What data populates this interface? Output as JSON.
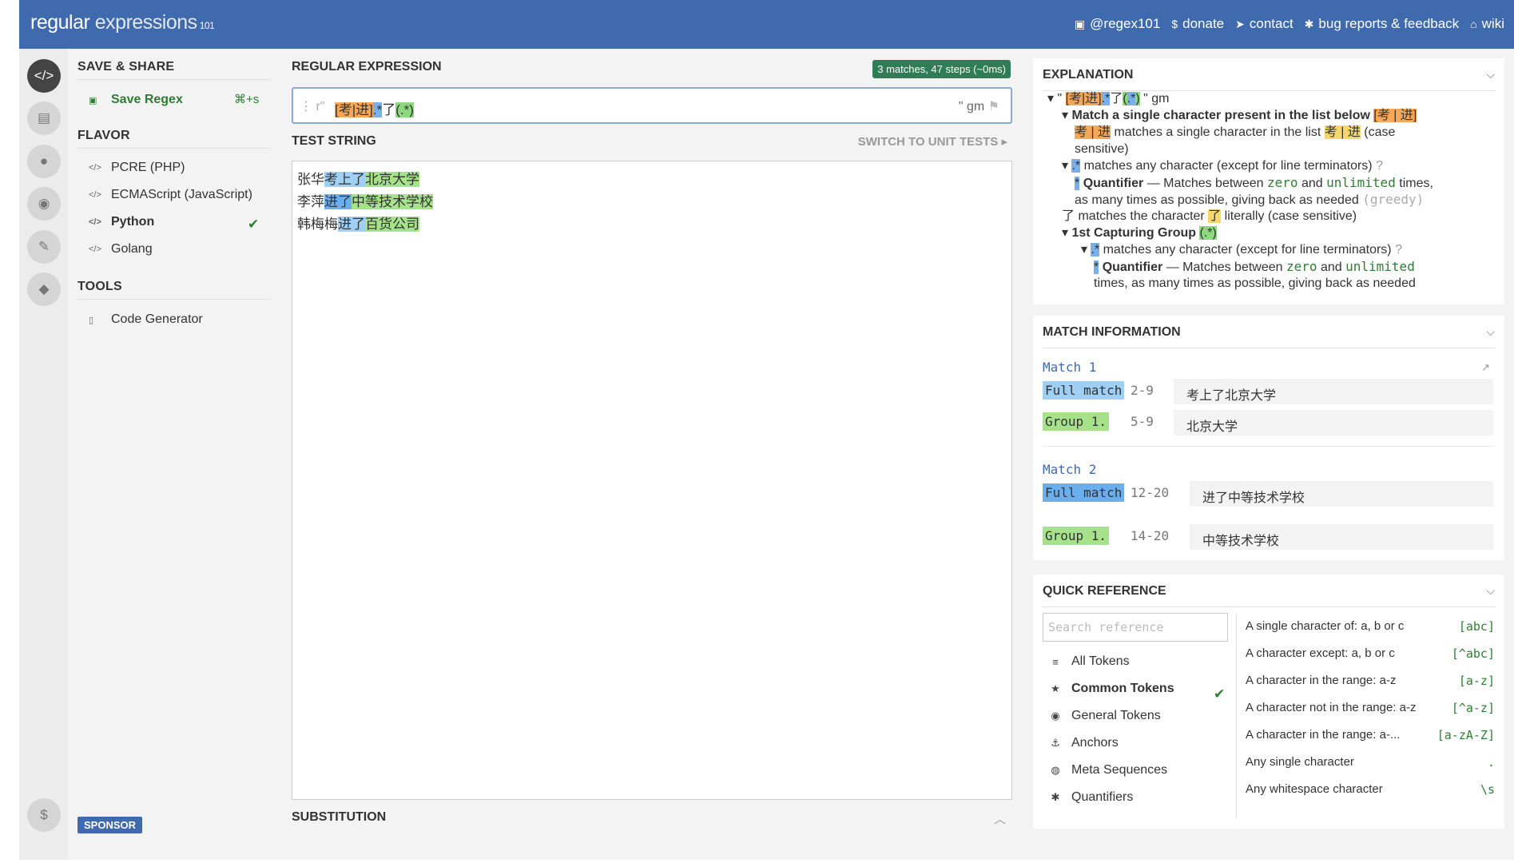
{
  "header": {
    "logo_main": "regular",
    "logo_second": " expressions",
    "logo_small": "101",
    "links": [
      {
        "icon": "twitter-icon",
        "label": "@regex101"
      },
      {
        "icon": "dollar-icon",
        "label": "donate"
      },
      {
        "icon": "send-icon",
        "label": "contact"
      },
      {
        "icon": "bug-icon",
        "label": "bug reports & feedback"
      },
      {
        "icon": "bank-icon",
        "label": "wiki"
      }
    ]
  },
  "sidebar": {
    "save_share_title": "SAVE & SHARE",
    "save_label": "Save Regex",
    "save_shortcut": "⌘+s",
    "flavor_title": "FLAVOR",
    "flavors": [
      "PCRE (PHP)",
      "ECMAScript (JavaScript)",
      "Python",
      "Golang"
    ],
    "selected_flavor": "Python",
    "tools_title": "TOOLS",
    "tool_code_generator": "Code Generator",
    "sponsor": "SPONSOR"
  },
  "regex": {
    "section_title": "REGULAR EXPRESSION",
    "status_badge": "3 matches, 47 steps (~0ms)",
    "prefix": "r\"",
    "pattern_class": "[考|进]",
    "pattern_any": ".*",
    "pattern_literal": "了",
    "pattern_group": "(.*)",
    "suffix": "\" gm",
    "flags": "\" gm"
  },
  "test_string": {
    "section_title": "TEST STRING",
    "switch_label": "SWITCH TO UNIT TESTS",
    "lines": [
      {
        "pre": "张华",
        "full": "考上了",
        "grp": "北京大学"
      },
      {
        "pre": "李萍",
        "full": "进了",
        "grp": "中等技术学校"
      },
      {
        "pre": "韩梅梅",
        "full": "进了",
        "grp": "百货公司"
      }
    ]
  },
  "substitution": {
    "title": "SUBSTITUTION"
  },
  "explanation": {
    "title": "EXPLANATION",
    "root_open": "\" ",
    "root_class": "[考|进]",
    "root_any": ".*",
    "root_lit": "了",
    "root_grp_open": "(",
    "root_grp_any": ".*",
    "root_grp_close": ")",
    "root_close": " \" gm",
    "l1_text": "Match a single character present in the list below ",
    "l1_token": "[考 | 进]",
    "l2_token": "考 | 进",
    "l2_text": " matches a single character in the list ",
    "l2_token2": "考 | 进",
    "l2_tail": " (case",
    "l3_text": "sensitive)",
    "l4_token": ".*",
    "l4_text": " matches any character (except for line terminators)",
    "l5_star": "*",
    "l5_bold": "Quantifier",
    "l5_text": " — Matches between ",
    "l5_zero": "zero",
    "l5_and": " and ",
    "l5_unl": "unlimited",
    "l5_tail": " times,",
    "l6_text": "as many times as possible, giving back as needed ",
    "l6_greedy": "(greedy)",
    "l7_char": "了",
    "l7_text": " matches the character ",
    "l7_tok": "了",
    "l7_tail": " literally (case sensitive)",
    "l8_bold": "1st Capturing Group ",
    "l8_tok": "(.*)",
    "l9_token": ".*",
    "l9_text": " matches any character (except for line terminators)",
    "l10_star": "*",
    "l10_bold": "Quantifier",
    "l10_text": " — Matches between ",
    "l10_zero": "zero",
    "l10_and": " and ",
    "l10_unl": "unlimited",
    "l11_text": "times, as many times as possible, giving back as needed"
  },
  "match_info": {
    "title": "MATCH INFORMATION",
    "matches": [
      {
        "title": "Match 1",
        "full_label": "Full match",
        "full_range": "2-9",
        "full_value": "考上了北京大学",
        "group_label": "Group 1.",
        "group_range": "5-9",
        "group_value": "北京大学"
      },
      {
        "title": "Match 2",
        "full_label": "Full match",
        "full_range": "12-20",
        "full_value": "进了中等技术学校",
        "group_label": "Group 1.",
        "group_range": "14-20",
        "group_value": "中等技术学校"
      }
    ]
  },
  "quick_reference": {
    "title": "QUICK REFERENCE",
    "search_placeholder": "Search reference",
    "categories": [
      {
        "icon": "database-icon",
        "label": "All Tokens"
      },
      {
        "icon": "star-icon",
        "label": "Common Tokens"
      },
      {
        "icon": "circle-dot-icon",
        "label": "General Tokens"
      },
      {
        "icon": "anchor-icon",
        "label": "Anchors"
      },
      {
        "icon": "globe-icon",
        "label": "Meta Sequences"
      },
      {
        "icon": "asterisk-icon",
        "label": "Quantifiers"
      }
    ],
    "selected_category": "Common Tokens",
    "items": [
      {
        "desc": "A single character of: a, b or c",
        "token": "[abc]"
      },
      {
        "desc": "A character except: a, b or c",
        "token": "[^abc]"
      },
      {
        "desc": "A character in the range: a-z",
        "token": "[a-z]"
      },
      {
        "desc": "A character not in the range: a-z",
        "token": "[^a-z]"
      },
      {
        "desc": "A character in the range: a-...",
        "token": "[a-zA-Z]"
      },
      {
        "desc": "Any single character",
        "token": "."
      },
      {
        "desc": "Any whitespace character",
        "token": "\\s"
      }
    ]
  },
  "colors": {
    "header_bg": "#3f6aad",
    "badge_bg": "#2e7d57",
    "full_match_hl": "#9fcff4",
    "group_hl": "#a6e28a",
    "class_token": "#f7a756",
    "any_token": "#7ab0e8"
  }
}
